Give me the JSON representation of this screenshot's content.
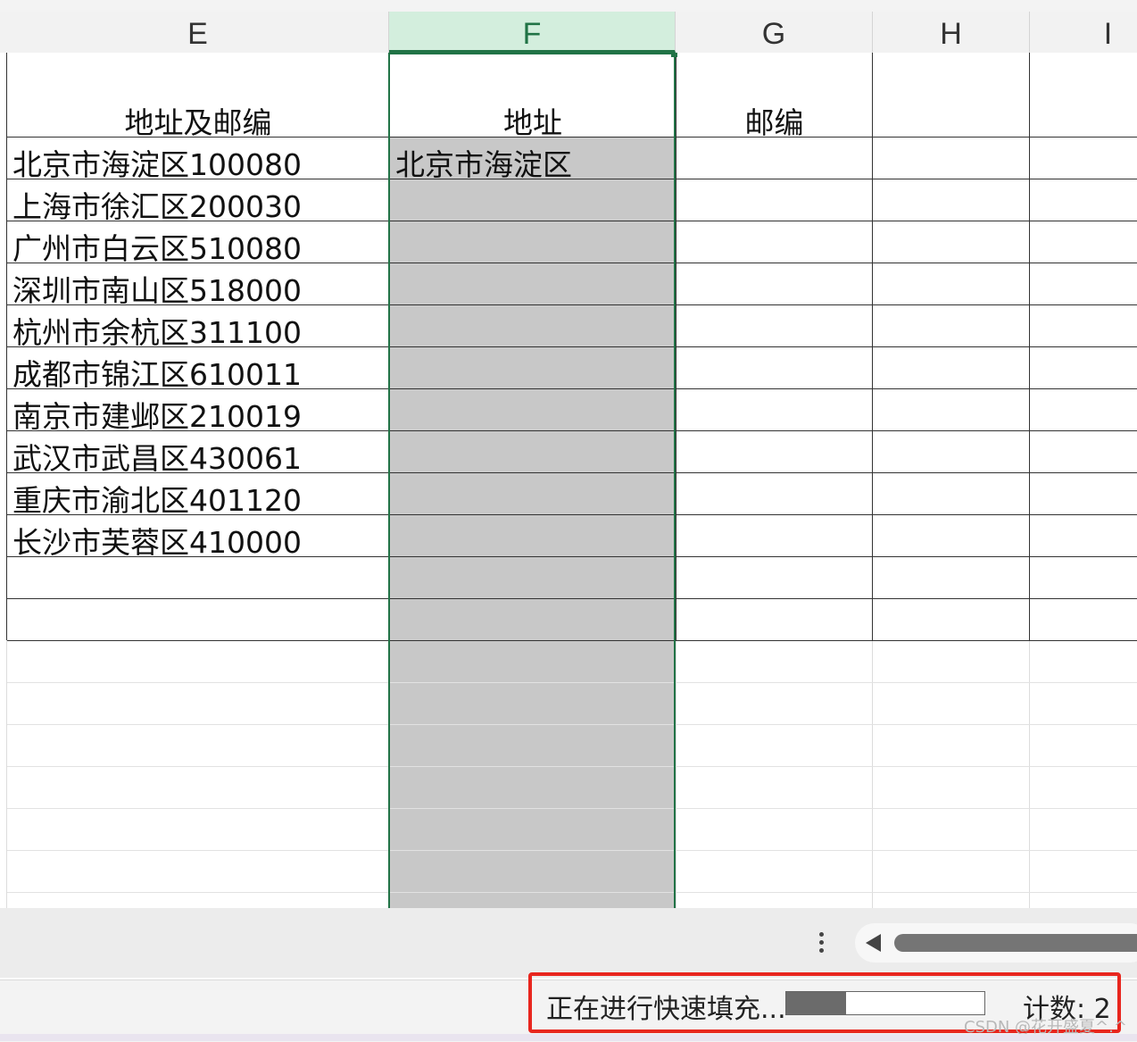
{
  "columns": [
    "E",
    "F",
    "G",
    "H",
    "I"
  ],
  "selected_column": "F",
  "header_row": {
    "E": "地址及邮编",
    "F": "地址",
    "G": "邮编"
  },
  "rows": [
    {
      "address_zip": "北京市海淀区100080",
      "address": "北京市海淀区"
    },
    {
      "address_zip": "上海市徐汇区200030",
      "address": ""
    },
    {
      "address_zip": "广州市白云区510080",
      "address": ""
    },
    {
      "address_zip": "深圳市南山区518000",
      "address": ""
    },
    {
      "address_zip": "杭州市余杭区311100",
      "address": ""
    },
    {
      "address_zip": "成都市锦江区610011",
      "address": ""
    },
    {
      "address_zip": "南京市建邺区210019",
      "address": ""
    },
    {
      "address_zip": "武汉市武昌区430061",
      "address": ""
    },
    {
      "address_zip": "重庆市渝北区401120",
      "address": ""
    },
    {
      "address_zip": "长沙市芙蓉区410000",
      "address": ""
    }
  ],
  "status": {
    "message": "正在进行快速填充...",
    "progress_fraction": 0.3,
    "count_label": "计数: 2",
    "progress_fill_color": "#6b6b6b",
    "highlight_color": "#e8261e"
  },
  "watermark": "CSDN @花开盛夏^.^",
  "icons": {
    "more": "more-vertical-icon",
    "scroll_left": "scroll-left-icon"
  },
  "colors": {
    "selection_border": "#217346",
    "selection_fill": "#c8c8c8",
    "header_selected_bg": "#d3eedd"
  }
}
